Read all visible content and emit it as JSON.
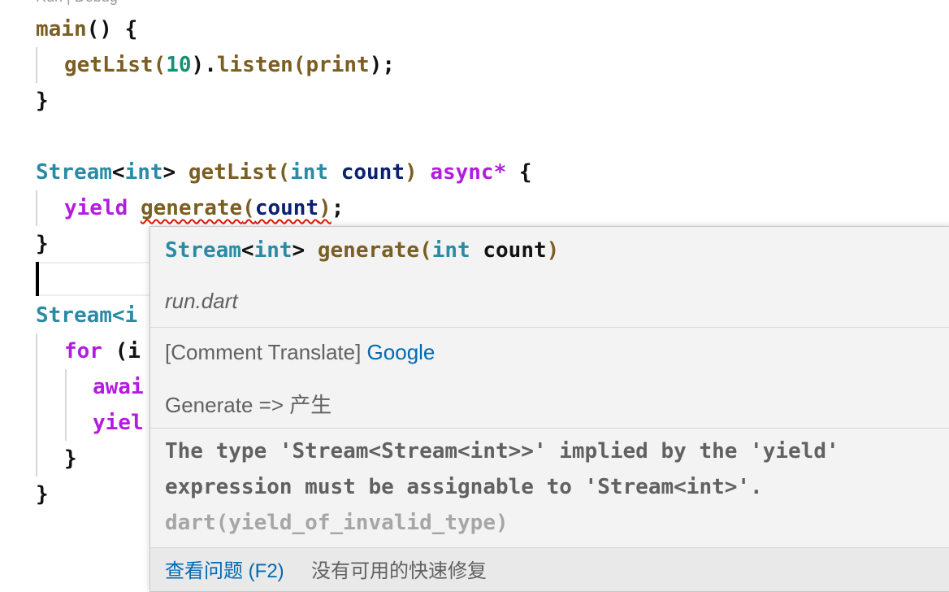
{
  "codelens": "Run | Debug",
  "code": {
    "main_name": "main",
    "open_sig": "() {",
    "getlist_call": "getList",
    "paren_open": "(",
    "arg_count": "10",
    "paren_close_dot": ").",
    "listen": "listen",
    "print": "print",
    "call_end": ");",
    "brace_close": "}",
    "stream": "Stream",
    "lt": "<",
    "int": "int",
    "gt": ">",
    "getlist_name": "getList",
    "count": "count",
    "paren_close": ")",
    "async_star": "async*",
    "brace_open": "{",
    "yield": "yield",
    "generate": "generate",
    "semicolon": ";",
    "stream_partial": "Stream<i",
    "for_kw": "for",
    "for_partial": "(i",
    "await_partial": "awai",
    "yield_partial": "yiel"
  },
  "hover": {
    "sig_type": "Stream",
    "sig_lt": "<",
    "sig_int": "int",
    "sig_gt": "> ",
    "sig_fn": "generate",
    "sig_paren_open": "(",
    "sig_param_type": "int",
    "sig_param_name": " count",
    "sig_paren_close": ")",
    "file": "run.dart",
    "comment_translate_label": "[Comment Translate] ",
    "comment_translate_link": "Google",
    "translation": "Generate => 产生",
    "diagnostic_message": "The type 'Stream<Stream<int>>' implied by the 'yield' expression must be assignable to 'Stream<int>'. ",
    "diagnostic_code": "dart(yield_of_invalid_type)",
    "view_problem": "查看问题 (F2)",
    "no_quick_fix": "没有可用的快速修复"
  }
}
